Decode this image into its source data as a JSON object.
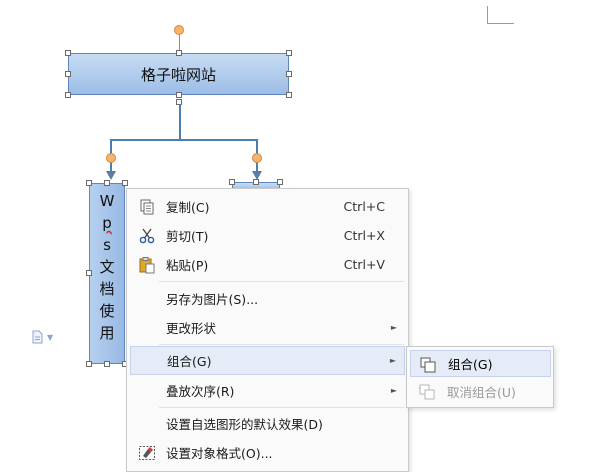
{
  "diagram": {
    "root_label": "格子啦网站",
    "child_text_chars": [
      "W",
      "p",
      "s",
      "文",
      "档",
      "使",
      "用"
    ]
  },
  "context_menu": {
    "items": [
      {
        "label": "复制(C)",
        "shortcut": "Ctrl+C",
        "icon": "copy-icon"
      },
      {
        "label": "剪切(T)",
        "shortcut": "Ctrl+X",
        "icon": "scissors-icon"
      },
      {
        "label": "粘贴(P)",
        "shortcut": "Ctrl+V",
        "icon": "paste-icon"
      },
      {
        "label": "另存为图片(S)..."
      },
      {
        "label": "更改形状"
      },
      {
        "label": "组合(G)"
      },
      {
        "label": "叠放次序(R)"
      },
      {
        "label": "设置自选图形的默认效果(D)"
      },
      {
        "label": "设置对象格式(O)...",
        "icon": "format-object-icon"
      }
    ]
  },
  "submenu": {
    "items": [
      {
        "label": "组合(G)",
        "icon": "group-icon",
        "enabled": true
      },
      {
        "label": "取消组合(U)",
        "icon": "ungroup-icon",
        "enabled": false
      }
    ]
  },
  "colors": {
    "shape_fill": "#a9c6ea",
    "connector": "#4a7faf",
    "rotation_handle": "#f5b46b",
    "menu_hover": "#e5ecf7"
  }
}
